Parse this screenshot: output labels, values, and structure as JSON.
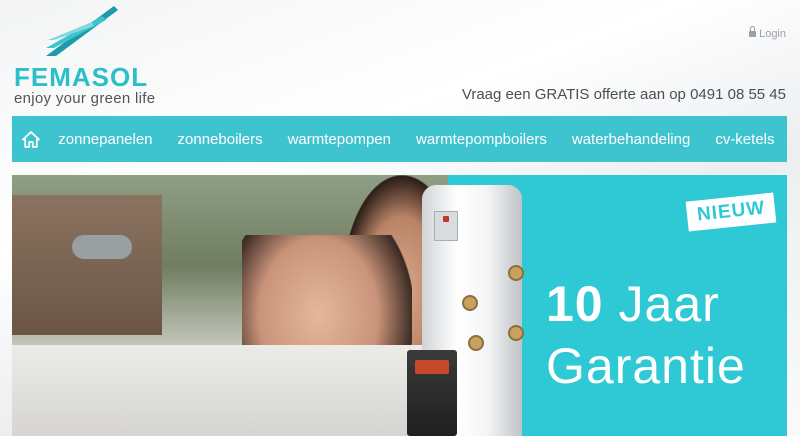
{
  "brand": {
    "name": "FEMASOL",
    "tagline": "enjoy your green life",
    "colors": {
      "accent": "#3ec4cf",
      "logo": "#2bbfc9"
    }
  },
  "header": {
    "login_label": "Login",
    "login_icon": "lock-icon",
    "cta_text": "Vraag een GRATIS offerte aan op 0491 08 55 45"
  },
  "nav": {
    "home_icon": "home-icon",
    "items": [
      {
        "label": "zonnepanelen"
      },
      {
        "label": "zonneboilers"
      },
      {
        "label": "warmtepompen"
      },
      {
        "label": "warmtepompboilers"
      },
      {
        "label": "waterbehandeling"
      },
      {
        "label": "cv-ketels"
      }
    ]
  },
  "banner": {
    "badge": "NIEUW",
    "headline_number": "10",
    "headline_word": "Jaar",
    "headline_line2": "Garantie",
    "background": "#2ec9d4"
  }
}
